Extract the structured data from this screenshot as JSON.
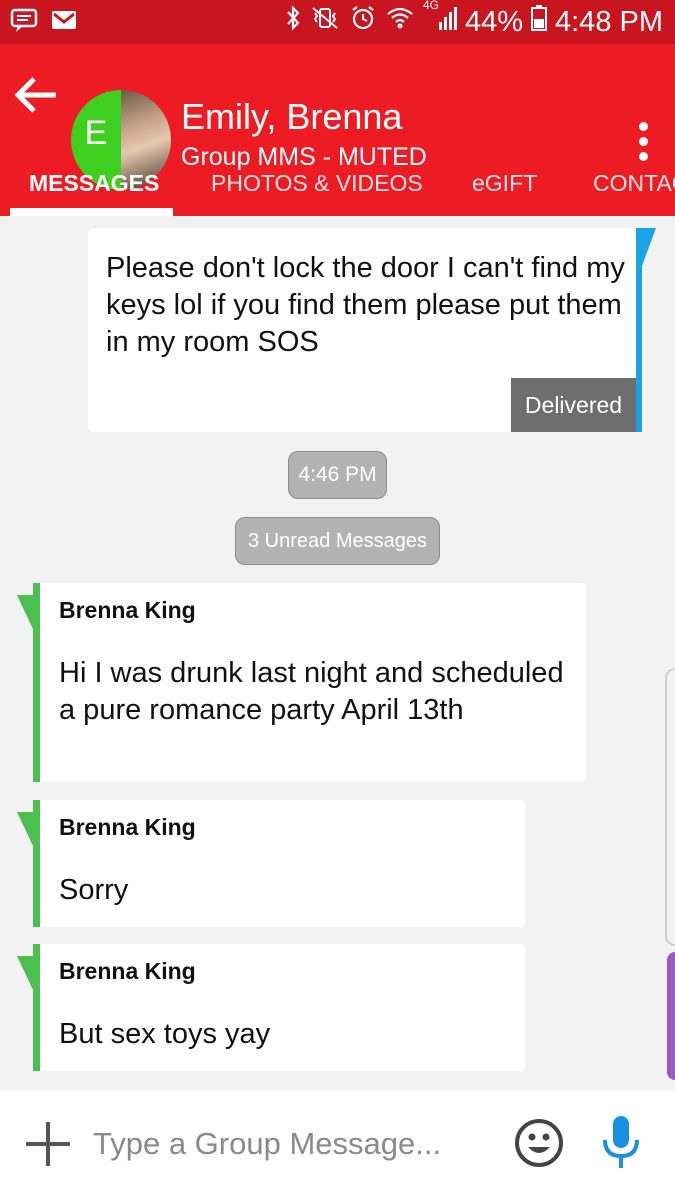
{
  "status_bar": {
    "battery": "44%",
    "time": "4:48 PM",
    "network": "4G"
  },
  "header": {
    "avatar_letter": "E",
    "title": "Emily, Brenna",
    "subtitle": "Group MMS - MUTED"
  },
  "tabs": [
    {
      "label": "MESSAGES"
    },
    {
      "label": "PHOTOS & VIDEOS"
    },
    {
      "label": "eGIFT"
    },
    {
      "label": "CONTAC"
    }
  ],
  "messages": {
    "outgoing": {
      "text": "Please don't lock the door I can't find my keys lol if you find them please put them in my room SOS",
      "status": "Delivered"
    },
    "timestamp": "4:46 PM",
    "unread_label": "3 Unread Messages",
    "incoming": [
      {
        "sender": "Brenna King",
        "text": "Hi I was drunk last night and scheduled a pure romance party April 13th"
      },
      {
        "sender": "Brenna King",
        "text": "Sorry"
      },
      {
        "sender": "Brenna King",
        "text": "But sex toys yay"
      }
    ]
  },
  "composer": {
    "placeholder": "Type a Group Message..."
  },
  "colors": {
    "header": "#ed1c24",
    "outgoing_accent": "#1aa4e6",
    "incoming_accent": "#4bbf4f"
  }
}
